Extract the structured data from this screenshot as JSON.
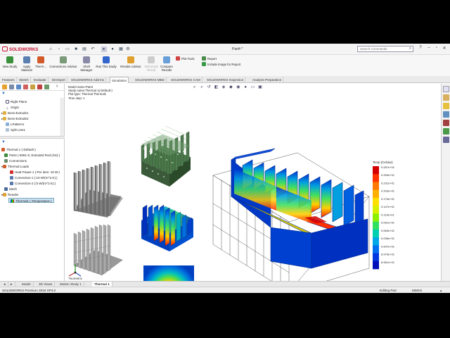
{
  "window": {
    "doc_title": "Part4 *",
    "search_placeholder": "Search Commands",
    "logo_text": "SOLIDWORKS"
  },
  "ribbon": {
    "buttons": [
      {
        "label": "New Study"
      },
      {
        "label": "Apply Material"
      },
      {
        "label": "Therm..."
      },
      {
        "label": "Connections Advisor"
      },
      {
        "label": "Shell Manager"
      },
      {
        "label": "Run This Study"
      },
      {
        "label": "Results Advisor"
      },
      {
        "label": "Deformed Result"
      },
      {
        "label": "Compare Results"
      },
      {
        "label": "Plot Tools"
      },
      {
        "label": "Report"
      },
      {
        "label": "Include Image for Report"
      }
    ]
  },
  "command_tabs": [
    "Features",
    "Sketch",
    "Evaluate",
    "DimXpert",
    "SOLIDWORKS Add-Ins",
    "Simulation",
    "SOLIDWORKS MBD",
    "SOLIDWORKS CAM",
    "SOLIDWORKS Inspection",
    "Analysis Preparation"
  ],
  "active_command_tab": "Simulation",
  "tree": {
    "top_items": [
      "Right Plane",
      "Origin",
      "Boss-Extrude1",
      "Boss-Extrude2",
      "LPattern1",
      "Split Line1"
    ],
    "study_items": [
      "Thermal 1 (-Default-)",
      "Part4 (-6061-0, Extruded Rod (SS)-)",
      "Connections",
      "Thermal Loads",
      "Heat Power-1 (:Per item: 15 W:)",
      "Convection-1 (:10 W/(m^2.K):)",
      "Convection-2 (:5 W/(m^2.K):)",
      "Mesh",
      "Results",
      "Thermal1 (-Temperature-)"
    ]
  },
  "study_info": {
    "lines": [
      "Model name:Part4",
      "Study name:Thermal 1(-Default-)",
      "Plot type: Thermal Thermal1",
      "Time step: 1"
    ]
  },
  "legend": {
    "title": "Temp (Celsius)",
    "values": [
      "9.287e+01",
      "9.259e+01",
      "9.231e+01",
      "9.203e+01",
      "9.175e+01",
      "9.147e+01",
      "9.119e+01",
      "9.091e+01",
      "9.063e+01",
      "9.035e+01",
      "9.007e+01",
      "8.979e+01",
      "8.951e+01"
    ],
    "colors": [
      "#d40000",
      "#ff3300",
      "#ff7a00",
      "#ffb000",
      "#ffe000",
      "#d8f000",
      "#8cf000",
      "#30e060",
      "#00d0b0",
      "#00a8e8",
      "#0070f0",
      "#0038e0",
      "#0010b8"
    ]
  },
  "view_label": "*Isometric",
  "bottom_tabs": [
    "Model",
    "3D Views",
    "Motion Study 1",
    "Thermal 1"
  ],
  "active_bottom_tab": "Thermal 1",
  "status": {
    "left": "SOLIDWORKS Premium 2018 SP4.0",
    "editing": "Editing Part",
    "units": "MMGS"
  }
}
